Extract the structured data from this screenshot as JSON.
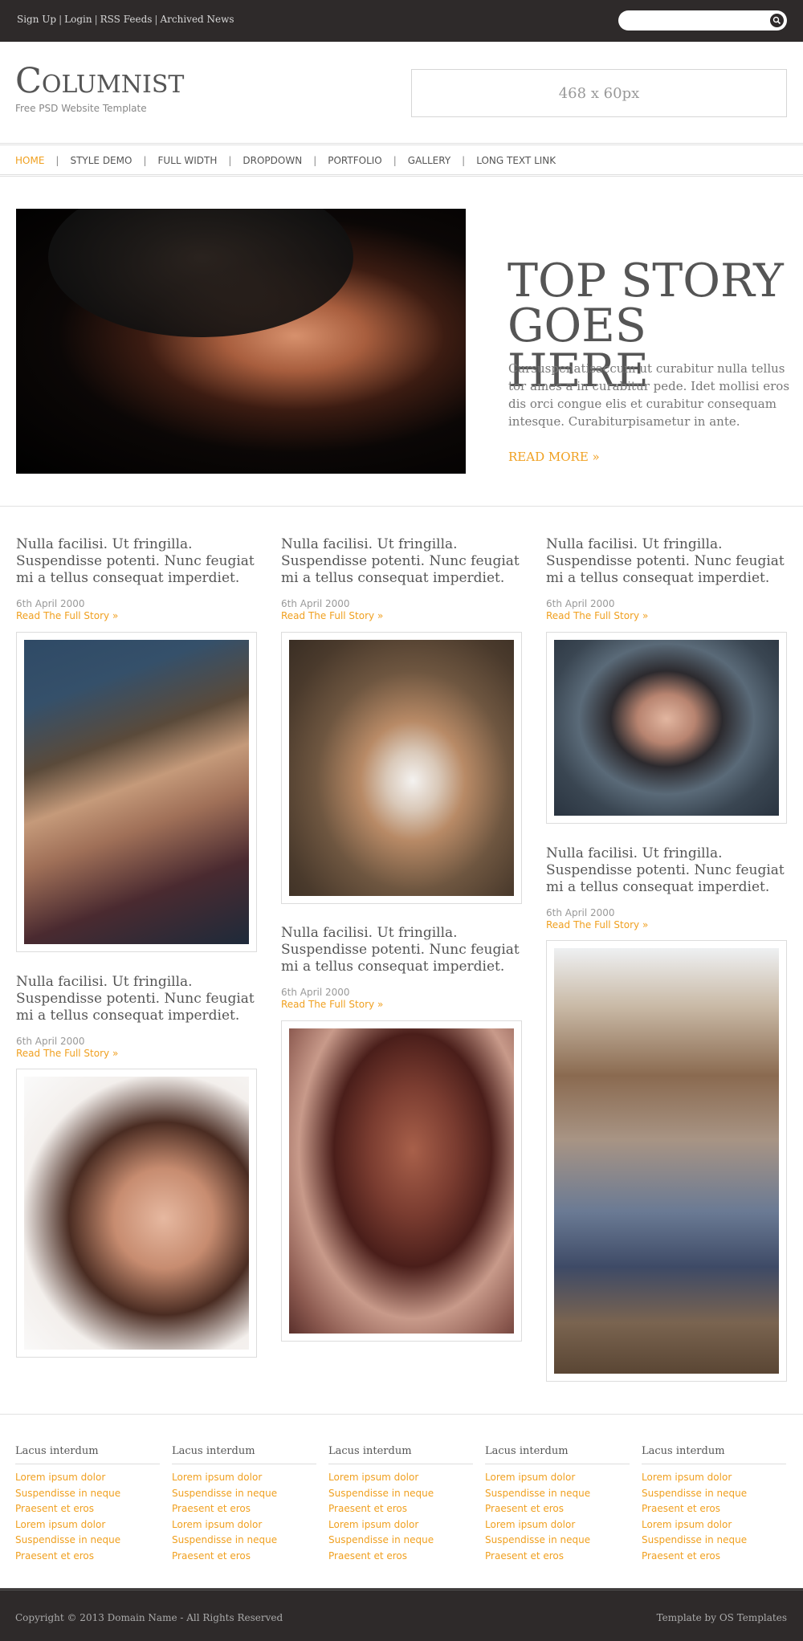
{
  "topbar": {
    "links": [
      "Sign Up",
      "Login",
      "RSS Feeds",
      "Archived News"
    ],
    "search_placeholder": ""
  },
  "header": {
    "logo": "Columnist",
    "tagline": "Free PSD Website Template",
    "ad_label": "468 x 60px"
  },
  "nav": {
    "items": [
      "HOME",
      "STYLE DEMO",
      "FULL WIDTH",
      "DROPDOWN",
      "PORTFOLIO",
      "GALLERY",
      "LONG TEXT LINK"
    ],
    "active": "HOME"
  },
  "hero": {
    "title": "TOP STORY GOES HERE",
    "text": "Cursuspenatisaccum ut curabitur nulla tellus tor ames a in curabitur pede. Idet mollisi eros dis orci congue elis et curabitur consequam intesque. Curabiturpisametur in ante.",
    "more": "READ MORE »"
  },
  "articles": [
    {
      "title": "Nulla facilisi. Ut fringilla. Suspendisse potenti. Nunc feugiat mi a tellus consequat imperdiet.",
      "date": "6th April 2000",
      "more": "Read The Full Story »"
    },
    {
      "title": "Nulla facilisi. Ut fringilla. Suspendisse potenti. Nunc feugiat mi a tellus consequat imperdiet.",
      "date": "6th April 2000",
      "more": "Read The Full Story »"
    },
    {
      "title": "Nulla facilisi. Ut fringilla. Suspendisse potenti. Nunc feugiat mi a tellus consequat imperdiet.",
      "date": "6th April 2000",
      "more": "Read The Full Story »"
    },
    {
      "title": "Nulla facilisi. Ut fringilla. Suspendisse potenti. Nunc feugiat mi a tellus consequat imperdiet.",
      "date": "6th April 2000",
      "more": "Read The Full Story »"
    },
    {
      "title": "Nulla facilisi. Ut fringilla. Suspendisse potenti. Nunc feugiat mi a tellus consequat imperdiet.",
      "date": "6th April 2000",
      "more": "Read The Full Story »"
    },
    {
      "title": "Nulla facilisi. Ut fringilla. Suspendisse potenti. Nunc feugiat mi a tellus consequat imperdiet.",
      "date": "6th April 2000",
      "more": "Read The Full Story »"
    }
  ],
  "footer_columns": [
    {
      "title": "Lacus interdum",
      "links": [
        "Lorem ipsum dolor",
        "Suspendisse in neque",
        "Praesent et eros",
        "Lorem ipsum dolor",
        "Suspendisse in neque",
        "Praesent et eros"
      ]
    },
    {
      "title": "Lacus interdum",
      "links": [
        "Lorem ipsum dolor",
        "Suspendisse in neque",
        "Praesent et eros",
        "Lorem ipsum dolor",
        "Suspendisse in neque",
        "Praesent et eros"
      ]
    },
    {
      "title": "Lacus interdum",
      "links": [
        "Lorem ipsum dolor",
        "Suspendisse in neque",
        "Praesent et eros",
        "Lorem ipsum dolor",
        "Suspendisse in neque",
        "Praesent et eros"
      ]
    },
    {
      "title": "Lacus interdum",
      "links": [
        "Lorem ipsum dolor",
        "Suspendisse in neque",
        "Praesent et eros",
        "Lorem ipsum dolor",
        "Suspendisse in neque",
        "Praesent et eros"
      ]
    },
    {
      "title": "Lacus interdum",
      "links": [
        "Lorem ipsum dolor",
        "Suspendisse in neque",
        "Praesent et eros",
        "Lorem ipsum dolor",
        "Suspendisse in neque",
        "Praesent et eros"
      ]
    }
  ],
  "bottom": {
    "copyright": "Copyright © 2013 Domain Name - All Rights Reserved",
    "credit": "Template by OS Templates"
  },
  "colors": {
    "accent": "#f0a020",
    "dark_bar": "#2e2a2a",
    "text": "#555555"
  }
}
